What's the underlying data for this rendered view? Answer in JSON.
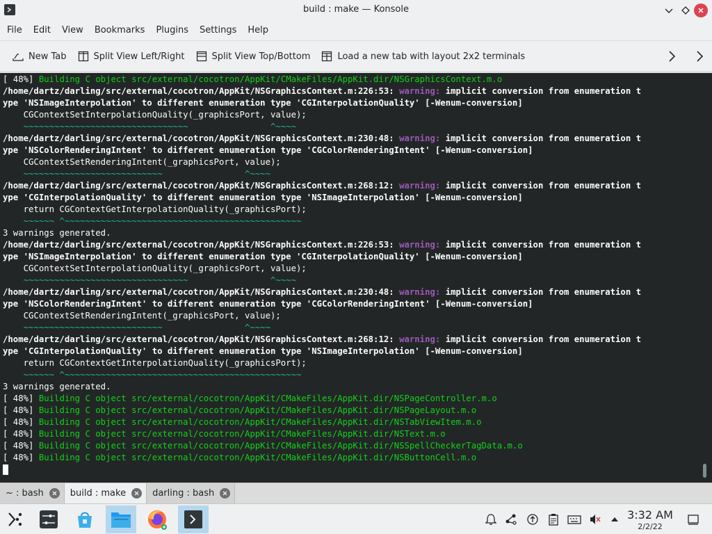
{
  "window": {
    "title": "build : make — Konsole",
    "icon": "terminal-icon"
  },
  "menu": [
    "File",
    "Edit",
    "View",
    "Bookmarks",
    "Plugins",
    "Settings",
    "Help"
  ],
  "toolbar": {
    "new_tab": "New Tab",
    "split_lr": "Split View Left/Right",
    "split_tb": "Split View Top/Bottom",
    "load_layout": "Load a new tab with layout 2x2 terminals"
  },
  "terminal": {
    "lines": [
      {
        "type": "build",
        "prefix": "[ 48%] ",
        "text": "Building C object src/external/cocotron/AppKit/CMakeFiles/AppKit.dir/NSGraphicsContext.m.o"
      },
      {
        "type": "warning",
        "path": "/home/dartz/darling/src/external/cocotron/AppKit/NSGraphicsContext.m:226:53: ",
        "label": "warning:",
        "msg": " implicit conversion from enumeration t"
      },
      {
        "type": "bold",
        "text": "ype 'NSImageInterpolation' to different enumeration type 'CGInterpolationQuality' [-Wenum-conversion]"
      },
      {
        "type": "plain",
        "text": "    CGContextSetInterpolationQuality(_graphicsPort, value);"
      },
      {
        "type": "caret",
        "text": "    ~~~~~~~~~~~~~~~~~~~~~~~~~~~~~~~~                ^~~~~"
      },
      {
        "type": "warning",
        "path": "/home/dartz/darling/src/external/cocotron/AppKit/NSGraphicsContext.m:230:48: ",
        "label": "warning:",
        "msg": " implicit conversion from enumeration t"
      },
      {
        "type": "bold",
        "text": "ype 'NSColorRenderingIntent' to different enumeration type 'CGColorRenderingIntent' [-Wenum-conversion]"
      },
      {
        "type": "plain",
        "text": "    CGContextSetRenderingIntent(_graphicsPort, value);"
      },
      {
        "type": "caret",
        "text": "    ~~~~~~~~~~~~~~~~~~~~~~~~~~~                ^~~~~"
      },
      {
        "type": "warning",
        "path": "/home/dartz/darling/src/external/cocotron/AppKit/NSGraphicsContext.m:268:12: ",
        "label": "warning:",
        "msg": " implicit conversion from enumeration t"
      },
      {
        "type": "bold",
        "text": "ype 'CGInterpolationQuality' to different enumeration type 'NSImageInterpolation' [-Wenum-conversion]"
      },
      {
        "type": "plain",
        "text": "    return CGContextGetInterpolationQuality(_graphicsPort);"
      },
      {
        "type": "caret",
        "text": "    ~~~~~~ ^~~~~~~~~~~~~~~~~~~~~~~~~~~~~~~~~~~~~~~~~~~~~~~"
      },
      {
        "type": "plain",
        "text": "3 warnings generated."
      },
      {
        "type": "warning",
        "path": "/home/dartz/darling/src/external/cocotron/AppKit/NSGraphicsContext.m:226:53: ",
        "label": "warning:",
        "msg": " implicit conversion from enumeration t"
      },
      {
        "type": "bold",
        "text": "ype 'NSImageInterpolation' to different enumeration type 'CGInterpolationQuality' [-Wenum-conversion]"
      },
      {
        "type": "plain",
        "text": "    CGContextSetInterpolationQuality(_graphicsPort, value);"
      },
      {
        "type": "caret",
        "text": "    ~~~~~~~~~~~~~~~~~~~~~~~~~~~~~~~~                ^~~~~"
      },
      {
        "type": "warning",
        "path": "/home/dartz/darling/src/external/cocotron/AppKit/NSGraphicsContext.m:230:48: ",
        "label": "warning:",
        "msg": " implicit conversion from enumeration t"
      },
      {
        "type": "bold",
        "text": "ype 'NSColorRenderingIntent' to different enumeration type 'CGColorRenderingIntent' [-Wenum-conversion]"
      },
      {
        "type": "plain",
        "text": "    CGContextSetRenderingIntent(_graphicsPort, value);"
      },
      {
        "type": "caret",
        "text": "    ~~~~~~~~~~~~~~~~~~~~~~~~~~~                ^~~~~"
      },
      {
        "type": "warning",
        "path": "/home/dartz/darling/src/external/cocotron/AppKit/NSGraphicsContext.m:268:12: ",
        "label": "warning:",
        "msg": " implicit conversion from enumeration t"
      },
      {
        "type": "bold",
        "text": "ype 'CGInterpolationQuality' to different enumeration type 'NSImageInterpolation' [-Wenum-conversion]"
      },
      {
        "type": "plain",
        "text": "    return CGContextGetInterpolationQuality(_graphicsPort);"
      },
      {
        "type": "caret",
        "text": "    ~~~~~~ ^~~~~~~~~~~~~~~~~~~~~~~~~~~~~~~~~~~~~~~~~~~~~~~"
      },
      {
        "type": "plain",
        "text": "3 warnings generated."
      },
      {
        "type": "build",
        "prefix": "[ 48%] ",
        "text": "Building C object src/external/cocotron/AppKit/CMakeFiles/AppKit.dir/NSPageController.m.o"
      },
      {
        "type": "build",
        "prefix": "[ 48%] ",
        "text": "Building C object src/external/cocotron/AppKit/CMakeFiles/AppKit.dir/NSPageLayout.m.o"
      },
      {
        "type": "build",
        "prefix": "[ 48%] ",
        "text": "Building C object src/external/cocotron/AppKit/CMakeFiles/AppKit.dir/NSTabViewItem.m.o"
      },
      {
        "type": "build",
        "prefix": "[ 48%] ",
        "text": "Building C object src/external/cocotron/AppKit/CMakeFiles/AppKit.dir/NSText.m.o"
      },
      {
        "type": "build",
        "prefix": "[ 48%] ",
        "text": "Building C object src/external/cocotron/AppKit/CMakeFiles/AppKit.dir/NSSpellCheckerTagData.m.o"
      },
      {
        "type": "build",
        "prefix": "[ 48%] ",
        "text": "Building C object src/external/cocotron/AppKit/CMakeFiles/AppKit.dir/NSButtonCell.m.o"
      },
      {
        "type": "cursor"
      }
    ]
  },
  "tabs": [
    {
      "label": "~ : bash",
      "active": false
    },
    {
      "label": "build : make",
      "active": true
    },
    {
      "label": "darling : bash",
      "active": false
    }
  ],
  "taskbar": {
    "apps": [
      "app-launcher-icon",
      "system-settings-icon",
      "discover-store-icon",
      "file-manager-icon",
      "firefox-icon",
      "konsole-icon"
    ],
    "tray": [
      "notifications-icon",
      "network-share-icon",
      "updates-icon",
      "clipboard-icon",
      "keyboard-icon",
      "volume-muted-icon",
      "show-hidden-icons-icon",
      "show-desktop-icon"
    ],
    "clock_time": "3:32 AM",
    "clock_date": "2/2/22"
  },
  "colors": {
    "terminal_bg": "#232627",
    "terminal_fg": "#fcfcfc",
    "build_green": "#11d116",
    "warning_magenta": "#9b59b6",
    "caret_cyan": "#1abc9c",
    "close_red": "#da4453"
  }
}
